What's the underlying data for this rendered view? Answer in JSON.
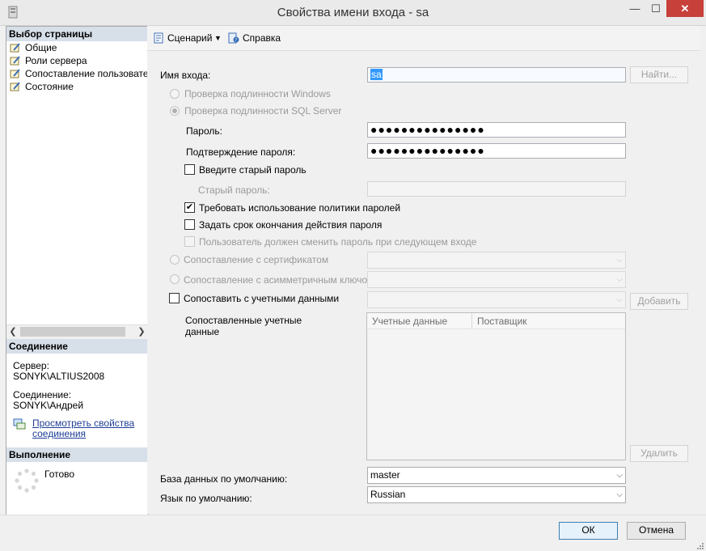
{
  "window": {
    "title": "Свойства имени входа - sa"
  },
  "titlebar": {
    "minimize": "—",
    "maximize": "☐",
    "close": "✕"
  },
  "left_pane": {
    "pages_header": "Выбор страницы",
    "pages": [
      {
        "label": "Общие"
      },
      {
        "label": "Роли сервера"
      },
      {
        "label": "Сопоставление пользователей"
      },
      {
        "label": "Состояние"
      }
    ],
    "connection_header": "Соединение",
    "server_label": "Сервер:",
    "server_value": "SONYK\\ALTIUS2008",
    "connection_label": "Соединение:",
    "connection_value": "SONYK\\Андрей",
    "view_link_line1": "Просмотреть свойства",
    "view_link_line2": "соединения",
    "progress_header": "Выполнение",
    "progress_status": "Готово"
  },
  "toolbar": {
    "script_label": "Сценарий",
    "help_label": "Справка"
  },
  "form": {
    "login_name_label": "Имя входа:",
    "login_name_value": "sa",
    "find_button": "Найти...",
    "windows_auth_label": "Проверка подлинности Windows",
    "sql_auth_label": "Проверка подлинности SQL Server",
    "password_label": "Пароль:",
    "password_value": "●●●●●●●●●●●●●●●",
    "confirm_label": "Подтверждение пароля:",
    "confirm_value": "●●●●●●●●●●●●●●●",
    "old_password_check_label": "Введите старый пароль",
    "old_password_label": "Старый пароль:",
    "enforce_policy_label": "Требовать использование политики паролей",
    "enforce_policy_checked": true,
    "enforce_expiration_label": "Задать срок окончания действия пароля",
    "must_change_label": "Пользователь должен сменить пароль при следующем входе",
    "cert_map_label": "Сопоставление с сертификатом",
    "asym_key_map_label": "Сопоставление с асимметричным ключом",
    "credential_map_label": "Сопоставить с учетными данными",
    "add_button": "Добавить",
    "mapped_creds_label_line1": "Сопоставленные учетные",
    "mapped_creds_label_line2": "данные",
    "grid_col_credential": "Учетные данные",
    "grid_col_provider": "Поставщик",
    "remove_button": "Удалить",
    "default_db_label": "База данных по умолчанию:",
    "default_db_value": "master",
    "default_lang_label": "Язык по умолчанию:",
    "default_lang_value": "Russian"
  },
  "footer": {
    "ok_button": "ОК",
    "cancel_button": "Отмена"
  },
  "icons": {
    "page_icon": "wrench-page-icon",
    "script_icon": "script-icon",
    "help_icon": "help-icon",
    "connection_icon": "connection-properties-icon",
    "spinner_icon": "progress-spinner-icon"
  },
  "colors": {
    "section_header": "#d7dfe9",
    "selection": "#3399ff",
    "link": "#1f3f95",
    "close_button": "#c7403a"
  }
}
